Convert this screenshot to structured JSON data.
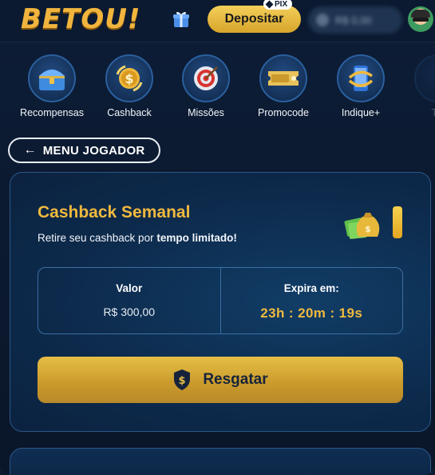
{
  "header": {
    "logo_text": "BETOU!",
    "deposit_label": "Depositar",
    "pix_label": "PIX",
    "balance_text": "R$ 0,00"
  },
  "nav": {
    "items": [
      {
        "label": "Recompensas",
        "icon": "treasure-chest-icon"
      },
      {
        "label": "Cashback",
        "icon": "cashback-coin-icon"
      },
      {
        "label": "Missões",
        "icon": "target-icon"
      },
      {
        "label": "Promocode",
        "icon": "ticket-icon"
      },
      {
        "label": "Indique+",
        "icon": "phone-share-icon"
      },
      {
        "label": "Tor",
        "icon": "tournament-icon"
      }
    ]
  },
  "menu": {
    "back_label": "MENU JOGADOR"
  },
  "cashback": {
    "title": "Cashback Semanal",
    "subtitle_prefix": "Retire seu cashback por ",
    "subtitle_bold": "tempo limitado!",
    "value_label": "Valor",
    "value_amount": "R$ 300,00",
    "expires_label": "Expira em:",
    "expires_timer": "23h : 20m : 19s",
    "claim_label": "Resgatar"
  },
  "colors": {
    "accent_gold": "#f0b93e",
    "background": "#0c1a30",
    "card_border": "#2b5788"
  }
}
